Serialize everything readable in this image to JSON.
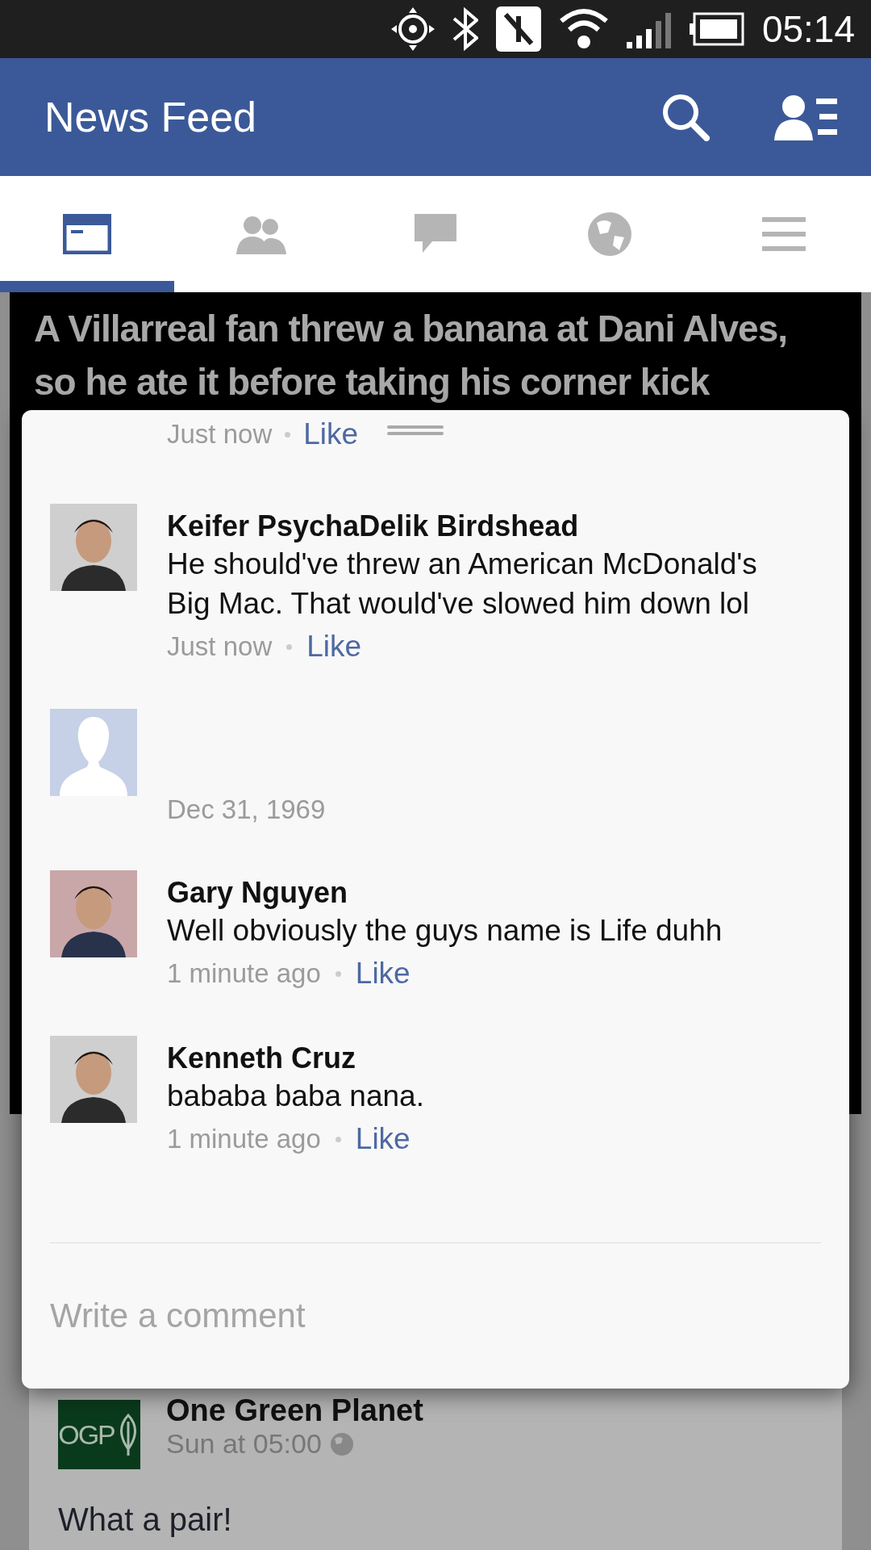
{
  "status_bar": {
    "time": "05:14"
  },
  "header": {
    "title": "News Feed"
  },
  "tabs": [
    {
      "kind": "feed",
      "selected": true
    },
    {
      "kind": "friends",
      "selected": false
    },
    {
      "kind": "messages",
      "selected": false
    },
    {
      "kind": "globe",
      "selected": false
    },
    {
      "kind": "menu",
      "selected": false
    }
  ],
  "post_image": {
    "headline": "A Villarreal fan threw a banana at Dani Alves, so he ate it before taking his corner kick"
  },
  "comments_sheet": {
    "partial_meta": {
      "time": "Just now",
      "like": "Like"
    },
    "comments": [
      {
        "name": "Keifer PsychaDelik Birdshead",
        "text": "He should've threw an American McDonald's Big Mac. That would've slowed him down lol",
        "time": "Just now",
        "like": "Like"
      },
      {
        "kind": "placeholder",
        "time": "Dec 31, 1969"
      },
      {
        "name": "Gary Nguyen",
        "text": "Well obviously the guys name is Life duhh",
        "time": "1 minute ago",
        "like": "Like"
      },
      {
        "name": "Kenneth Cruz",
        "text": "bababa baba nana.",
        "time": "1 minute ago",
        "like": "Like"
      }
    ],
    "composer": {
      "placeholder": "Write a comment"
    }
  },
  "next_post": {
    "logo_text": "OGP",
    "name": "One Green Planet",
    "time": "Sun at 05:00",
    "text": "What a pair!"
  }
}
